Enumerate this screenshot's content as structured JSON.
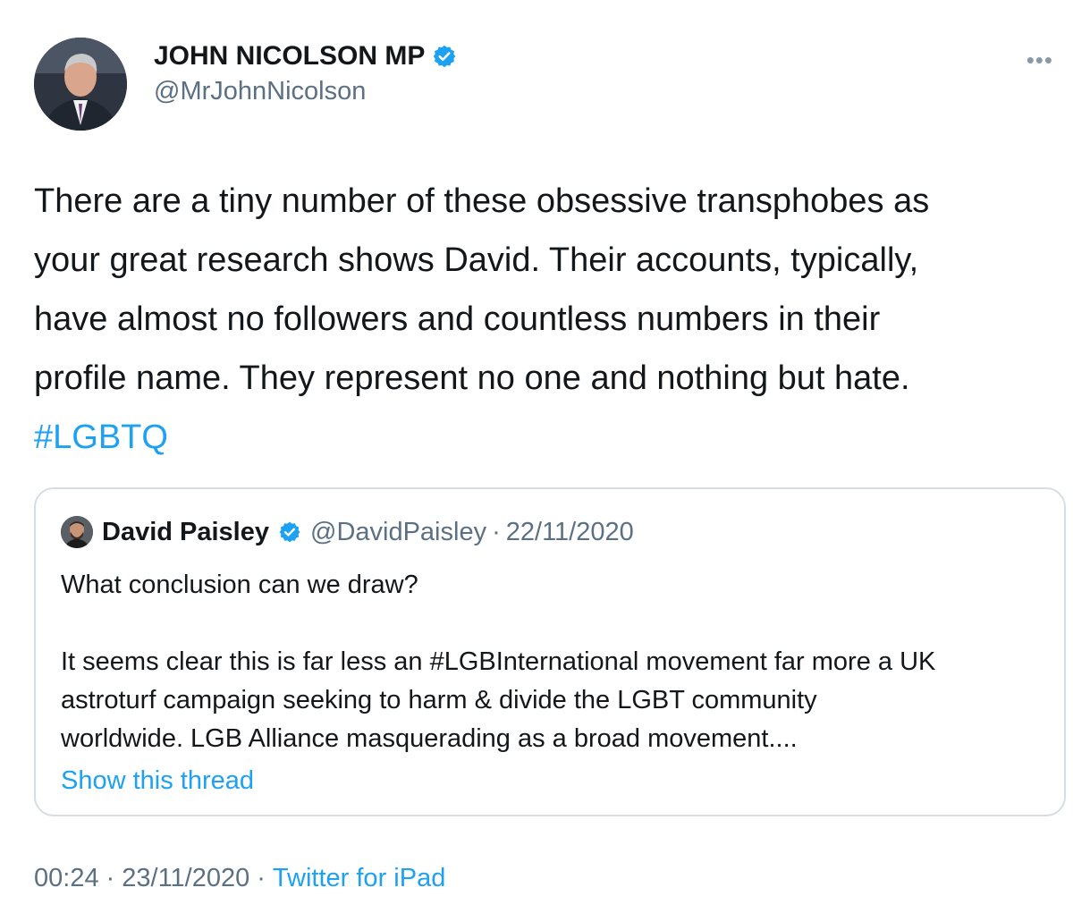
{
  "author": {
    "display_name": "JOHN NICOLSON MP",
    "handle": "@MrJohnNicolson",
    "verified_icon": "verified-badge-icon"
  },
  "more_menu": {
    "label": "•••"
  },
  "tweet": {
    "text": "There are a tiny number of these obsessive transphobes as\nyour great research shows David. Their accounts, typically,\nhave almost no followers and countless numbers in their\nprofile name. They represent no one and nothing but hate.",
    "hashtag": "#LGBTQ"
  },
  "quoted_tweet": {
    "display_name": "David Paisley",
    "handle": "@DavidPaisley",
    "separator": "·",
    "date": "22/11/2020",
    "text": "What conclusion can we draw?\n\nIt seems clear this is far less an #LGBInternational movement far more a UK\nastroturf campaign seeking to harm & divide the LGBT community\nworldwide. LGB Alliance masquerading as a broad movement....",
    "show_thread": "Show this thread"
  },
  "meta": {
    "time": "00:24",
    "separator1": "·",
    "date": "23/11/2020",
    "separator2": "·",
    "source": "Twitter for iPad"
  },
  "colors": {
    "link": "#1da1f2",
    "secondary_text": "#5b7083",
    "border": "#d6dde3"
  }
}
